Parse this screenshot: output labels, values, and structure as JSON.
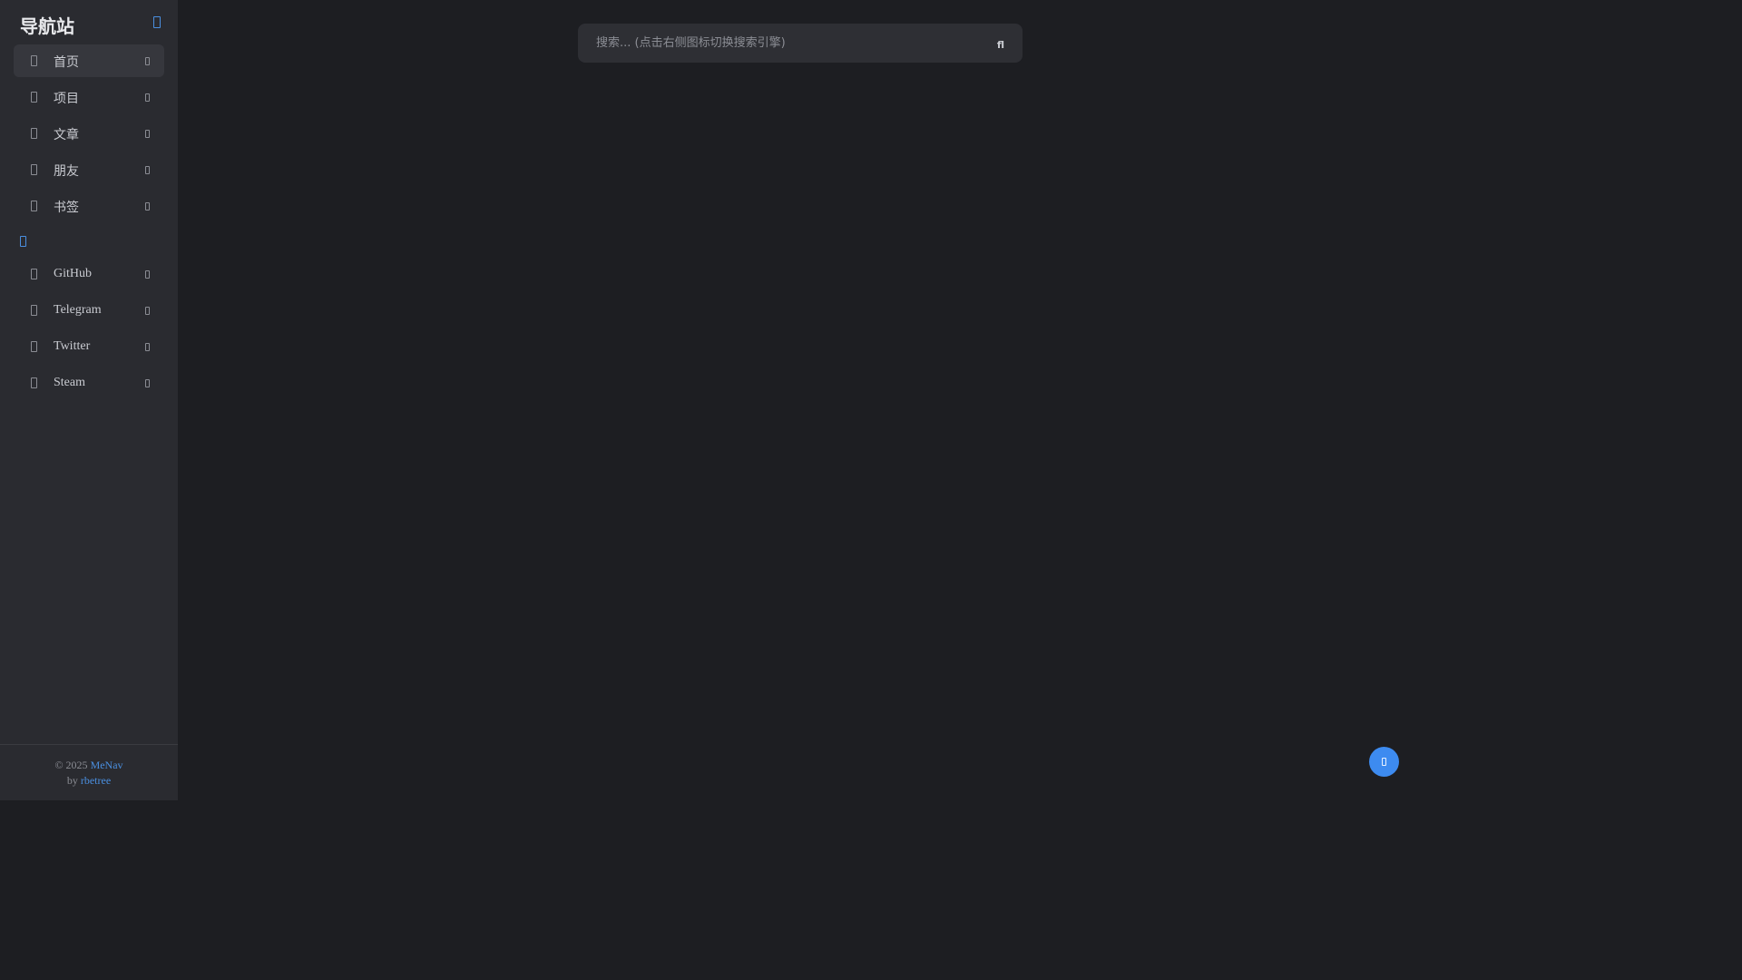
{
  "sidebar": {
    "brand": "导航站",
    "nav_items": [
      {
        "label": "首页",
        "active": true
      },
      {
        "label": "项目",
        "active": false
      },
      {
        "label": "文章",
        "active": false
      },
      {
        "label": "朋友",
        "active": false
      },
      {
        "label": "书签",
        "active": false
      }
    ],
    "social_items": [
      {
        "label": "GitHub"
      },
      {
        "label": "Telegram"
      },
      {
        "label": "Twitter"
      },
      {
        "label": "Steam"
      }
    ],
    "footer": {
      "copyright": "© 2025",
      "project_link": "MeNav",
      "by_text": "by",
      "author_link": "rbetree"
    }
  },
  "search": {
    "placeholder": "搜索... (点击右侧图标切换搜索引擎)",
    "icon_glyph": "fl"
  },
  "colors": {
    "accent": "#4a8fe0",
    "fab": "#3d8bf0",
    "background": "#1d1e22",
    "sidebar": "#2a2b30"
  }
}
